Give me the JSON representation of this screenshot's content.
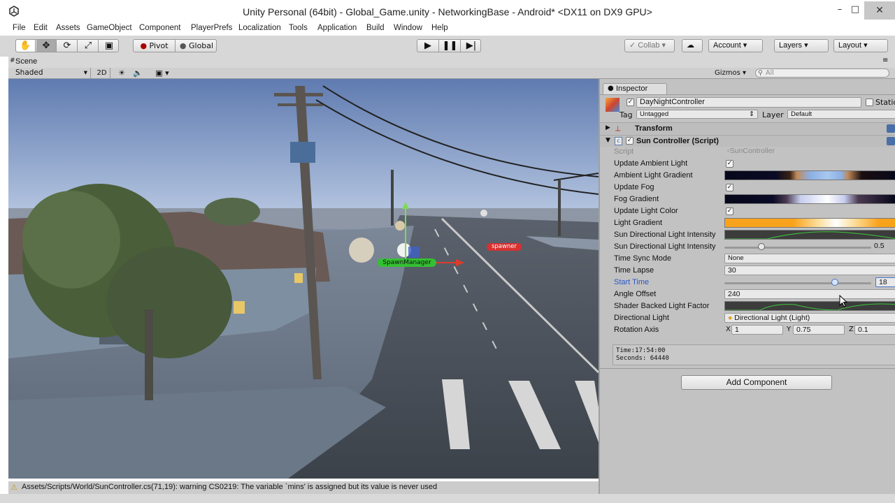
{
  "window": {
    "title": "Unity Personal (64bit) - Global_Game.unity - NetworkingBase - Android* <DX11 on DX9 GPU>",
    "minimize": "–",
    "maximize": "□",
    "close": "✕"
  },
  "menubar": {
    "items": [
      "File",
      "Edit",
      "Assets",
      "GameObject",
      "Component",
      "PlayerPrefs",
      "Localization",
      "Tools",
      "Application",
      "Build",
      "Window",
      "Help"
    ]
  },
  "toolbar": {
    "pivot_label": "Pivot",
    "global_label": "Global",
    "collab_label": "Collab",
    "account_label": "Account",
    "layers_label": "Layers",
    "layout_label": "Layout"
  },
  "scene": {
    "tab_label": "Scene",
    "shading_mode": "Shaded",
    "mode_2d": "2D",
    "gizmos_label": "Gizmos",
    "search_placeholder": "All",
    "labels": {
      "spawn_manager": "SpawnManager",
      "spawner": "spawner"
    }
  },
  "inspector": {
    "tab_label": "Inspector",
    "object_name": "DayNightController",
    "static_label": "Static",
    "tag_label": "Tag",
    "tag_value": "Untagged",
    "layer_label": "Layer",
    "layer_value": "Default",
    "transform_label": "Transform",
    "script_component_label": "Sun Controller (Script)",
    "fields": {
      "script": {
        "label": "Script",
        "value": "SunController"
      },
      "update_ambient_light": {
        "label": "Update Ambient Light",
        "checked": true
      },
      "ambient_light_gradient": {
        "label": "Ambient Light Gradient"
      },
      "update_fog": {
        "label": "Update Fog",
        "checked": true
      },
      "fog_gradient": {
        "label": "Fog Gradient"
      },
      "update_light_color": {
        "label": "Update Light Color",
        "checked": true
      },
      "light_gradient": {
        "label": "Light Gradient"
      },
      "sun_intensity_curve": {
        "label": "Sun Directional Light Intensity"
      },
      "sun_intensity": {
        "label": "Sun Directional Light Intensity",
        "value": "0.5",
        "fraction": 0.25
      },
      "time_sync_mode": {
        "label": "Time Sync Mode",
        "value": "None"
      },
      "time_lapse": {
        "label": "Time Lapse",
        "value": "30"
      },
      "start_time": {
        "label": "Start Time",
        "value": "18",
        "fraction": 0.75
      },
      "angle_offset": {
        "label": "Angle Offset",
        "value": "240"
      },
      "shader_backed_light_factor": {
        "label": "Shader Backed Light Factor"
      },
      "directional_light": {
        "label": "Directional Light",
        "value": "Directional Light (Light)"
      },
      "rotation_axis": {
        "label": "Rotation Axis",
        "x_label": "X",
        "x": "1",
        "y_label": "Y",
        "y": "0.75",
        "z_label": "Z",
        "z": "0.1"
      }
    },
    "info_time": "Time:17:54:00",
    "info_seconds": "Seconds: 64440",
    "add_component_label": "Add Component"
  },
  "statusbar": {
    "message": "Assets/Scripts/World/SunController.cs(71,19): warning CS0219: The variable `mins' is assigned but its value is never used"
  },
  "colors": {
    "toolbar_bg": "#d7d7d7",
    "inspector_bg": "#c2c2c2",
    "start_time_label": "#2a56c6",
    "light_gradient_orange": "#f9a21c"
  }
}
